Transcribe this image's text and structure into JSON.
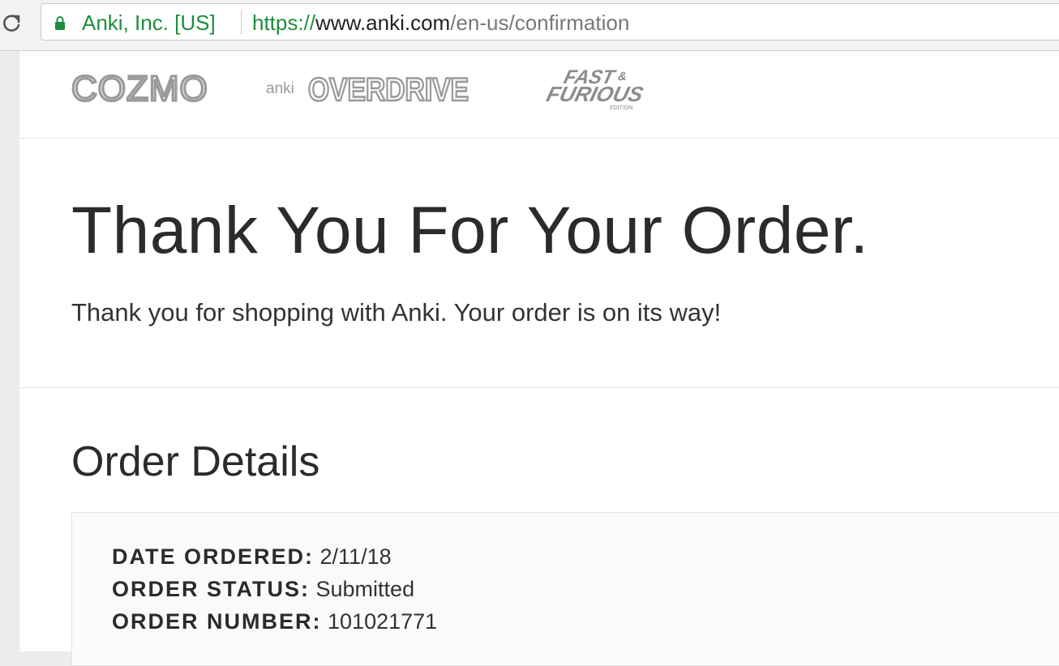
{
  "browser": {
    "site_identity": "Anki, Inc. [US]",
    "url_scheme": "https://",
    "url_host": "www.anki.com",
    "url_path": "/en-us/confirmation",
    "icons": [
      "reload-icon",
      "lock-icon"
    ]
  },
  "brands": [
    {
      "name": "COZMO",
      "icon": "cozmo-logo"
    },
    {
      "name": "anki OVERDRIVE",
      "prefix": "anki",
      "main": "OVERDRIVE",
      "icon": "overdrive-logo"
    },
    {
      "name": "FAST & FURIOUS EDITION",
      "line1": "FAST",
      "amp": "&",
      "line2": "FURIOUS",
      "edition": "EDITION",
      "icon": "fast-furious-logo"
    }
  ],
  "hero": {
    "title": "Thank You For Your Order.",
    "subtitle": "Thank you for shopping with Anki. Your order is on its way!"
  },
  "order": {
    "section_title": "Order Details",
    "rows": [
      {
        "label": "DATE ORDERED:",
        "value": "2/11/18"
      },
      {
        "label": "ORDER STATUS:",
        "value": "Submitted"
      },
      {
        "label": "ORDER NUMBER:",
        "value": "101021771"
      }
    ]
  },
  "colors": {
    "secure_green": "#1e8e3e",
    "logo_gray": "#9a9a9a",
    "text_dark": "#2b2b2b"
  }
}
